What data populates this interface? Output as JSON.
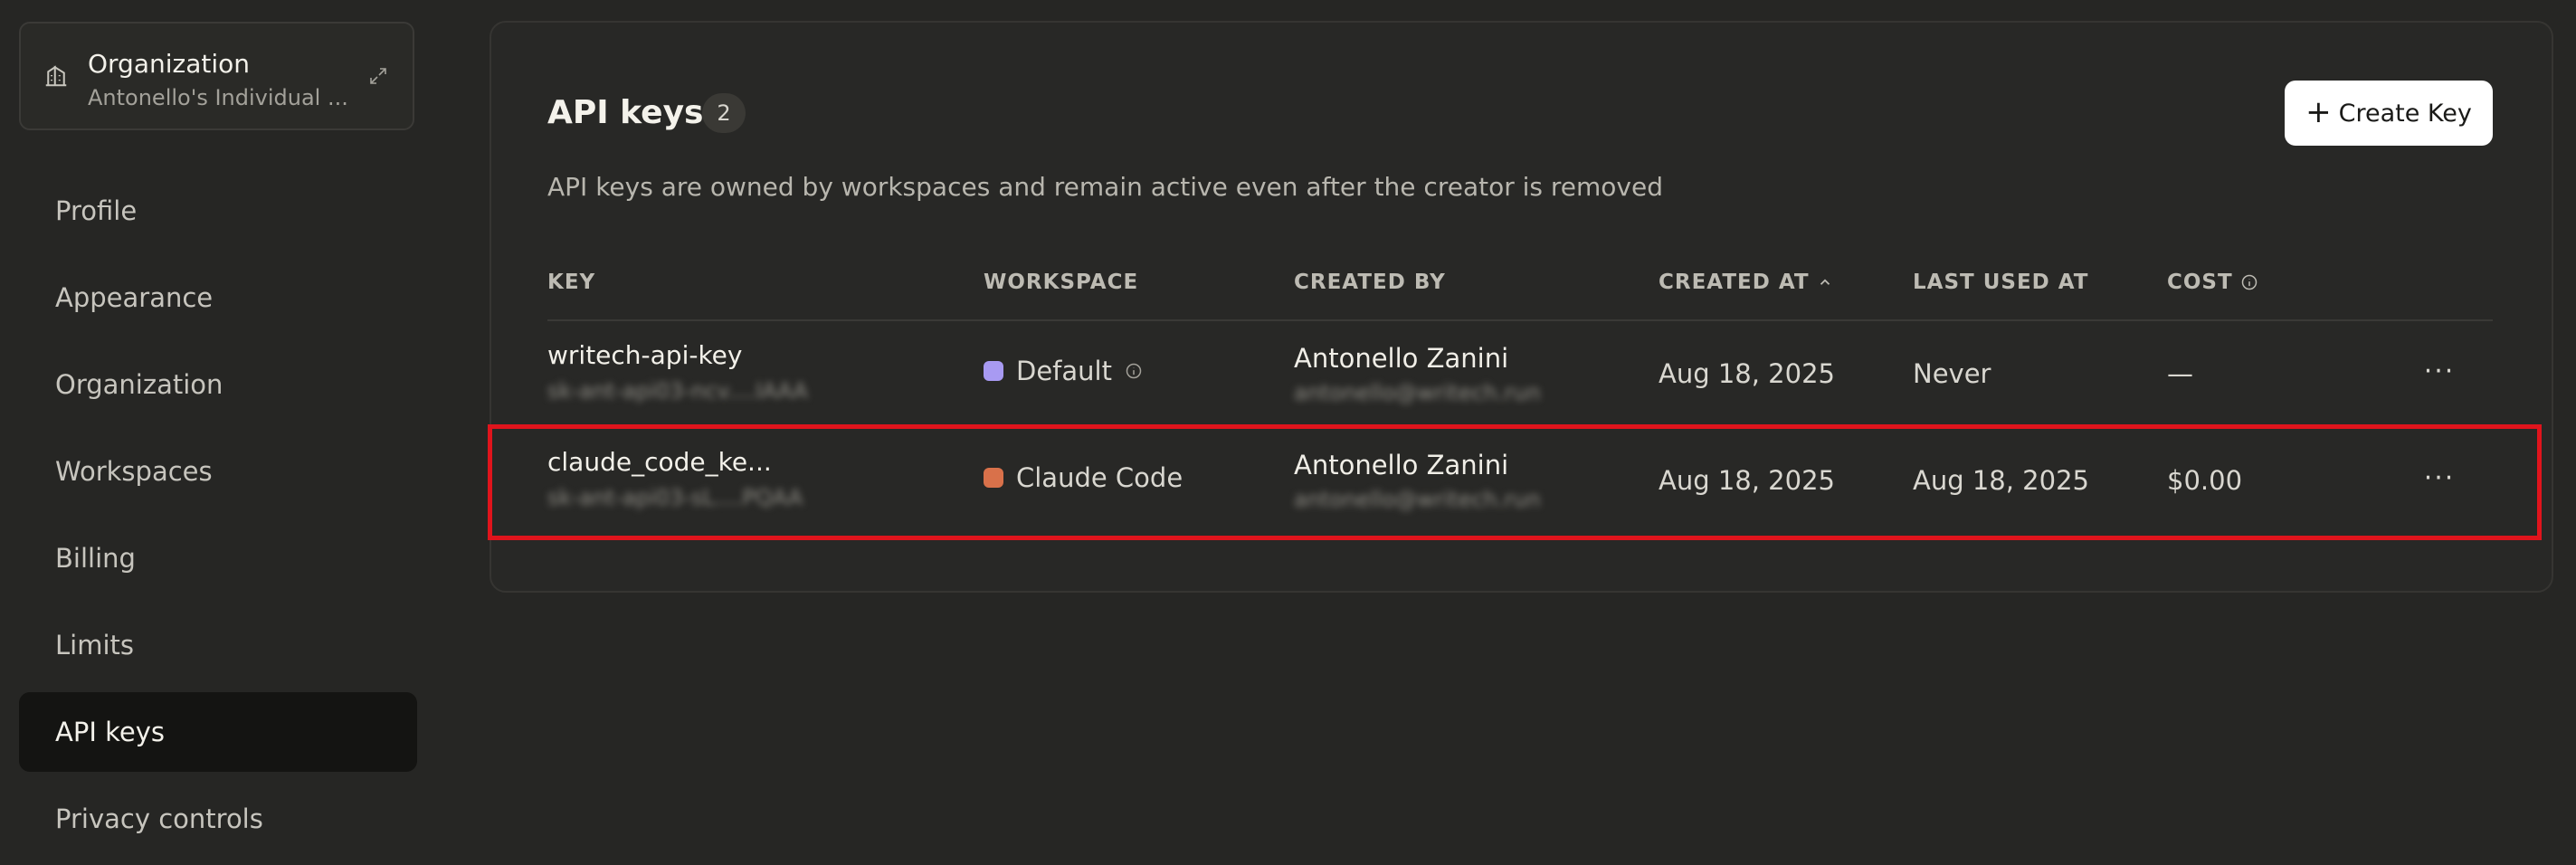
{
  "sidebar": {
    "org_switcher": {
      "title": "Organization",
      "subtitle": "Antonello's Individual ..."
    },
    "items": [
      {
        "label": "Profile",
        "active": false
      },
      {
        "label": "Appearance",
        "active": false
      },
      {
        "label": "Organization",
        "active": false
      },
      {
        "label": "Workspaces",
        "active": false
      },
      {
        "label": "Billing",
        "active": false
      },
      {
        "label": "Limits",
        "active": false
      },
      {
        "label": "API keys",
        "active": true
      },
      {
        "label": "Privacy controls",
        "active": false
      }
    ]
  },
  "main": {
    "title": "API keys",
    "count": "2",
    "create_button": "Create Key",
    "description": "API keys are owned by workspaces and remain active even after the creator is removed",
    "columns": [
      "KEY",
      "WORKSPACE",
      "CREATED BY",
      "CREATED AT",
      "LAST USED AT",
      "COST"
    ],
    "rows": [
      {
        "key_name": "writech-api-key",
        "key_secret": "sk-ant-api03-ncv....IAAA",
        "workspace": "Default",
        "workspace_color": "#a89af2",
        "created_by": "Antonello Zanini",
        "created_by_email": "antonello@writech.run",
        "created_at": "Aug 18, 2025",
        "last_used_at": "Never",
        "cost": "—"
      },
      {
        "key_name": "claude_code_ke...",
        "key_secret": "sk-ant-api03-sL....PQAA",
        "workspace": "Claude Code",
        "workspace_color": "#d9714a",
        "created_by": "Antonello Zanini",
        "created_by_email": "antonello@writech.run",
        "created_at": "Aug 18, 2025",
        "last_used_at": "Aug 18, 2025",
        "cost": "$0.00"
      }
    ]
  },
  "colors": {
    "background": "#262624",
    "highlight": "#e0141c",
    "button_bg": "#ffffff"
  }
}
